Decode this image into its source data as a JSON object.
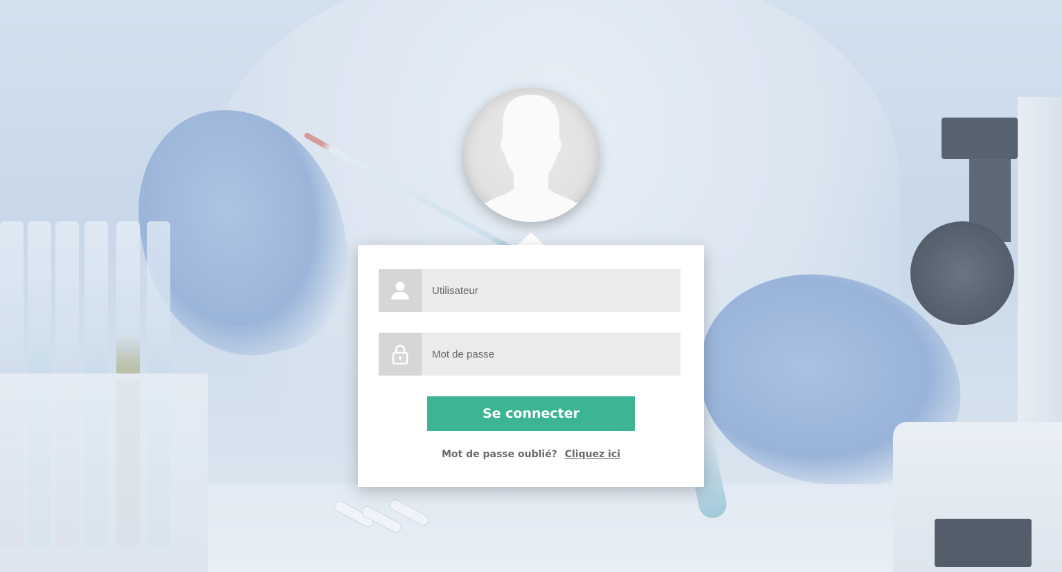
{
  "login": {
    "avatar_icon": "user-silhouette-icon",
    "username": {
      "icon": "user-icon",
      "placeholder": "Utilisateur",
      "value": ""
    },
    "password": {
      "icon": "lock-icon",
      "placeholder": "Mot de passe",
      "value": ""
    },
    "submit_label": "Se connecter",
    "forgot_text": "Mot de passe oublié?",
    "forgot_link": "Cliquez ici"
  },
  "colors": {
    "accent": "#3bb594",
    "field_bg": "#ebebeb",
    "icon_bg": "#d6d6d6",
    "card_bg": "#ffffff"
  }
}
